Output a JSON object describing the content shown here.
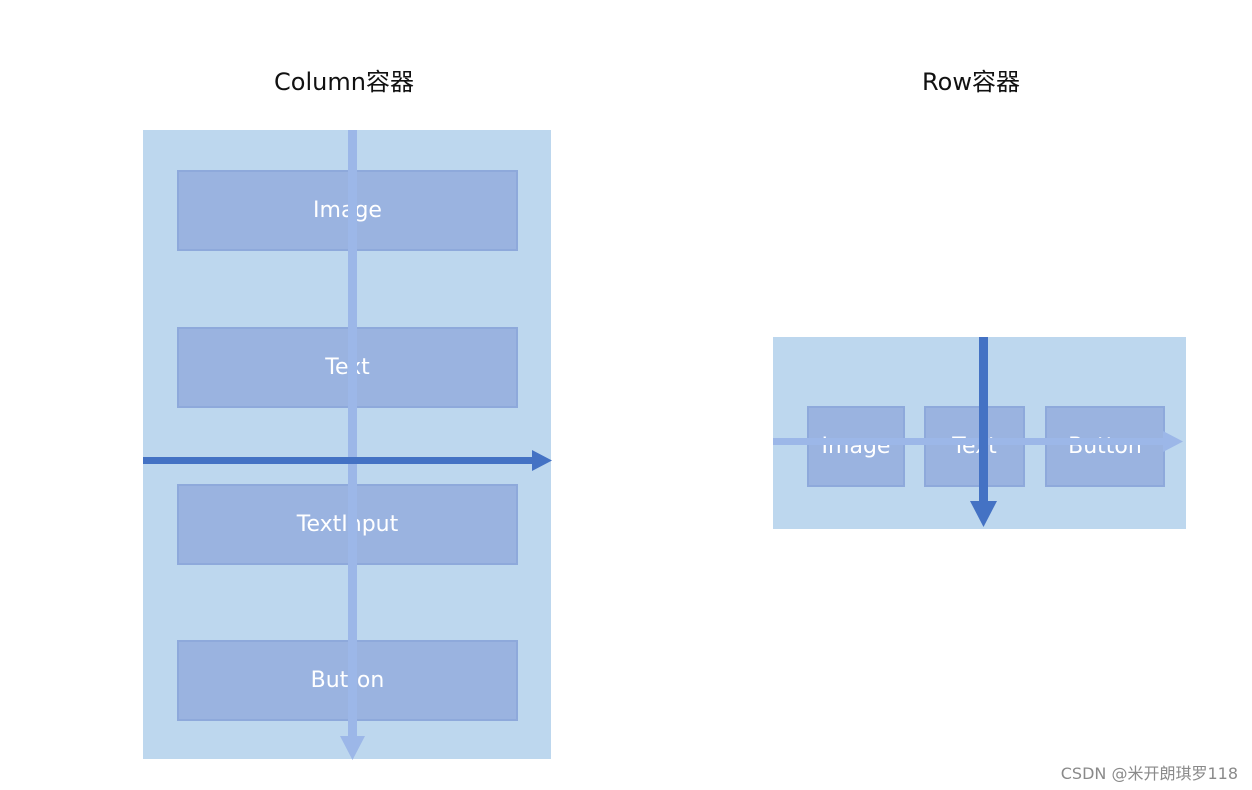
{
  "column": {
    "title": "Column容器",
    "items": [
      "Image",
      "Text",
      "TextInput",
      "Button"
    ]
  },
  "row": {
    "title": "Row容器",
    "items": [
      "Image",
      "Text",
      "Button"
    ]
  },
  "colors": {
    "container": "#BDD7EE",
    "item": "#9AB3E0",
    "main_axis_arrow": "#9CB7E8",
    "cross_axis_arrow": "#4472C4"
  },
  "watermark": "CSDN @米开朗琪罗118"
}
